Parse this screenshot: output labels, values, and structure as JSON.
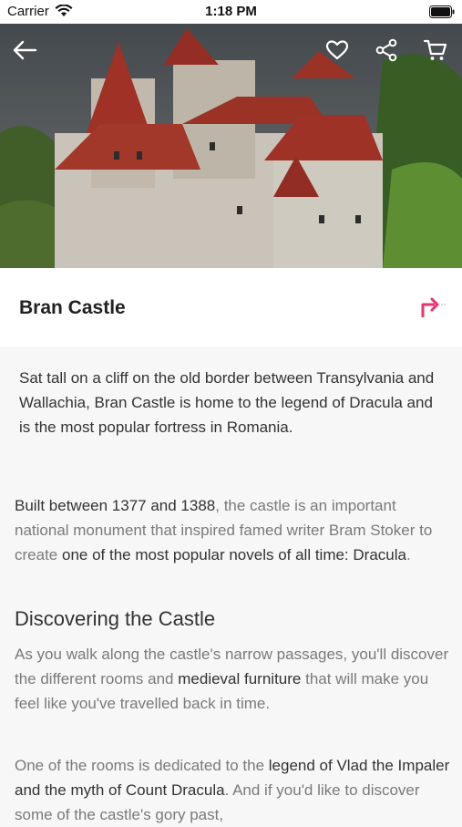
{
  "status": {
    "carrier": "Carrier",
    "time": "1:18 PM"
  },
  "header": {
    "icons": [
      "arrow-left-icon",
      "heart-icon",
      "share-icon",
      "cart-icon"
    ]
  },
  "place": {
    "title": "Bran Castle"
  },
  "intro": "Sat tall on a cliff on the old border between Transylvania and Wallachia, Bran Castle is home to the legend of Dracula and is the most popular fortress in Romania.",
  "paragraph1": {
    "b1": "Built between 1377 and 1388",
    "t1": ", the castle is an important national monument that inspired famed writer Bram Stoker to create ",
    "b2": "one of the most popular novels of all time: Dracula",
    "t2": "."
  },
  "section": {
    "heading": "Discovering the Castle",
    "p2_t1": "As you walk along the castle's narrow passages, you'll discover the different rooms and ",
    "p2_b1": "medieval furniture",
    "p2_t2": " that will make you feel like you've travelled back in time.",
    "p3_t1": "One of the rooms is dedicated to the ",
    "p3_b1": "legend of Vlad the Impaler and the myth of Count Dracula",
    "p3_t2": ". And if you'd like to discover some of the castle's gory past,"
  },
  "colors": {
    "accent": "#e8336d"
  }
}
